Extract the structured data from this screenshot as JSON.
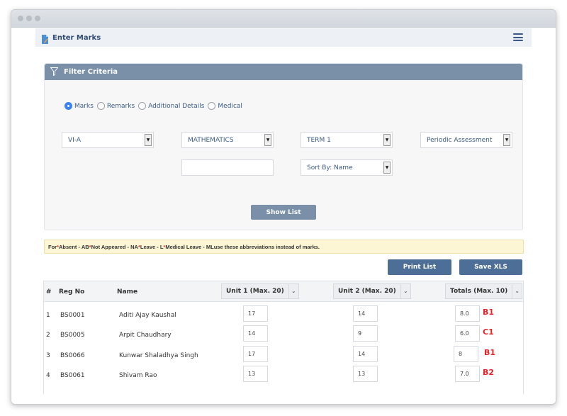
{
  "window": {
    "controls": [
      "close",
      "minimize",
      "maximize"
    ]
  },
  "header": {
    "title": "Enter Marks",
    "icon": "document-edit-icon",
    "menu_icon": "hamburger-menu-icon"
  },
  "filter": {
    "title": "Filter Criteria",
    "icon": "funnel-icon",
    "radios": [
      {
        "label": "Marks",
        "checked": true
      },
      {
        "label": "Remarks",
        "checked": false
      },
      {
        "label": "Additional Details",
        "checked": false
      },
      {
        "label": "Medical",
        "checked": false
      }
    ],
    "class_select": "VI-A",
    "subject_select": "MATHEMATICS",
    "term_select": "TERM 1",
    "assessment_select": "Periodic Assessment",
    "text_field": "",
    "sort_select": "Sort By: Name",
    "show_list_label": "Show List"
  },
  "notice": {
    "prefix": "For ",
    "items": [
      "Absent - AB ",
      "Not Appeared - NA ",
      "Leave - L ",
      "Medical Leave - ML"
    ],
    "suffix": " use these abbreviations instead of marks."
  },
  "actions": {
    "print_label": "Print List",
    "save_label": "Save XLS"
  },
  "table": {
    "headers": {
      "num": "#",
      "reg": "Reg No",
      "name": "Name",
      "unit1": "Unit 1 (Max. 20)",
      "unit2": "Unit 2 (Max. 20)",
      "totals": "Totals (Max. 10)"
    },
    "rows": [
      {
        "num": "1",
        "reg": "BS0001",
        "name": "Aditi Ajay Kaushal",
        "unit1": "17",
        "unit2": "14",
        "total": "8.0",
        "grade": "B1"
      },
      {
        "num": "2",
        "reg": "BS0005",
        "name": "Arpit Chaudhary",
        "unit1": "14",
        "unit2": "9",
        "total": "6.0",
        "grade": "C1"
      },
      {
        "num": "3",
        "reg": "BS0066",
        "name": "Kunwar Shaladhya Singh",
        "unit1": "17",
        "unit2": "14",
        "total": "8",
        "grade": "B1"
      },
      {
        "num": "4",
        "reg": "BS0061",
        "name": "Shivam Rao",
        "unit1": "13",
        "unit2": "13",
        "total": "7.0",
        "grade": "B2"
      }
    ]
  },
  "colors": {
    "accent": "#7a8fa8",
    "button": "#4d6f97",
    "grade": "#e0262a",
    "notice_bg": "#fdf6d5"
  }
}
